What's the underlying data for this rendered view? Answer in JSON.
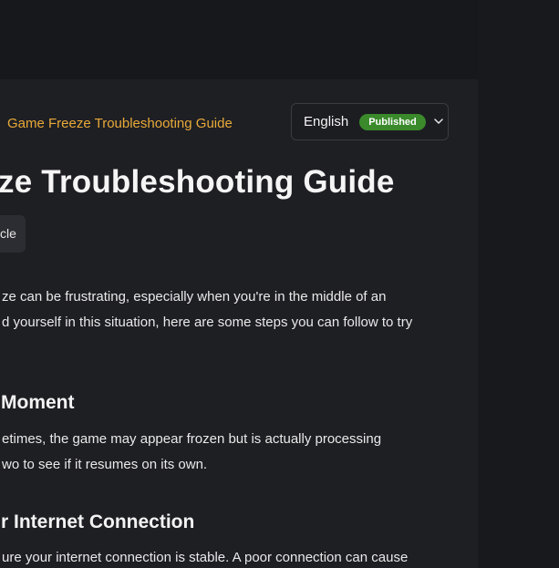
{
  "header": {
    "breadcrumb": "Game Freeze Troubleshooting Guide",
    "language": {
      "value": "English",
      "status": "Published"
    }
  },
  "article": {
    "title": "ze Troubleshooting Guide",
    "type_chip": "cle",
    "intro_line_1": "ze can be frustrating, especially when you're in the middle of an",
    "intro_line_2": "d yourself in this situation, here are some steps you can follow to try",
    "section_1_heading": "Moment",
    "section_1_line_1": "etimes, the game may appear frozen but is actually processing",
    "section_1_line_2": "wo to see if it resumes on its own.",
    "section_2_heading": "r Internet Connection",
    "section_2_line_1": "ure your internet connection is stable. A poor connection can cause"
  },
  "colors": {
    "accent": "#e8a93a",
    "badge": "#3a8a2c",
    "panel": "#1e1f23",
    "background": "#18191c"
  },
  "icons": {
    "language_dropdown": "chevron-down-icon"
  }
}
